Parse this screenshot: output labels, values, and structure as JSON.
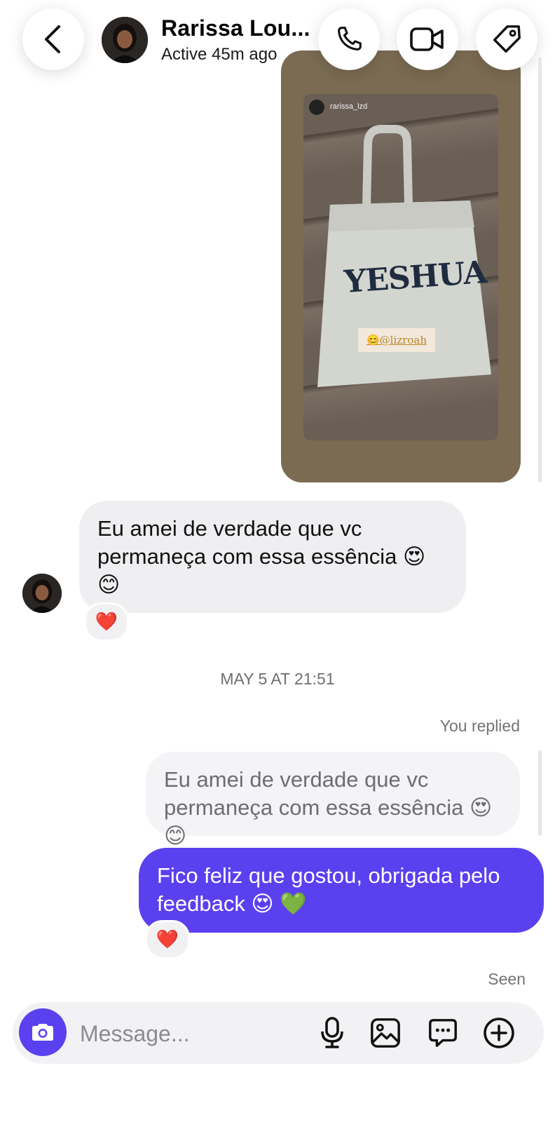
{
  "header": {
    "contact_name": "Rarissa Lou...",
    "status": "Active 45m ago",
    "icons": {
      "back": "chevron-left-icon",
      "call": "phone-icon",
      "video": "video-camera-icon",
      "tag": "tag-icon"
    }
  },
  "story": {
    "username": "rarissa_lzd",
    "bag_text": "YESHUA",
    "mention": "😊@lizroah"
  },
  "messages": {
    "incoming_1": "Eu amei de verdade que vc permaneça com essa essência 😍 😊",
    "incoming_1_reaction": "❤️",
    "date_divider": "MAY 5 AT 21:51",
    "you_replied_label": "You replied",
    "replied_to_text": "Eu amei de verdade que vc permaneça com essa essência 😍 😊",
    "outgoing_1": "Fico feliz que gostou, obrigada pelo feedback 😍 💚",
    "outgoing_1_reaction": "❤️",
    "seen_label": "Seen"
  },
  "composer": {
    "placeholder": "Message...",
    "icons": [
      "camera-icon",
      "microphone-icon",
      "image-icon",
      "sticker-chat-icon",
      "add-icon"
    ]
  },
  "colors": {
    "accent": "#5b40f0",
    "incoming_bubble": "#efeff2",
    "reply_text": "#6d6d72"
  }
}
